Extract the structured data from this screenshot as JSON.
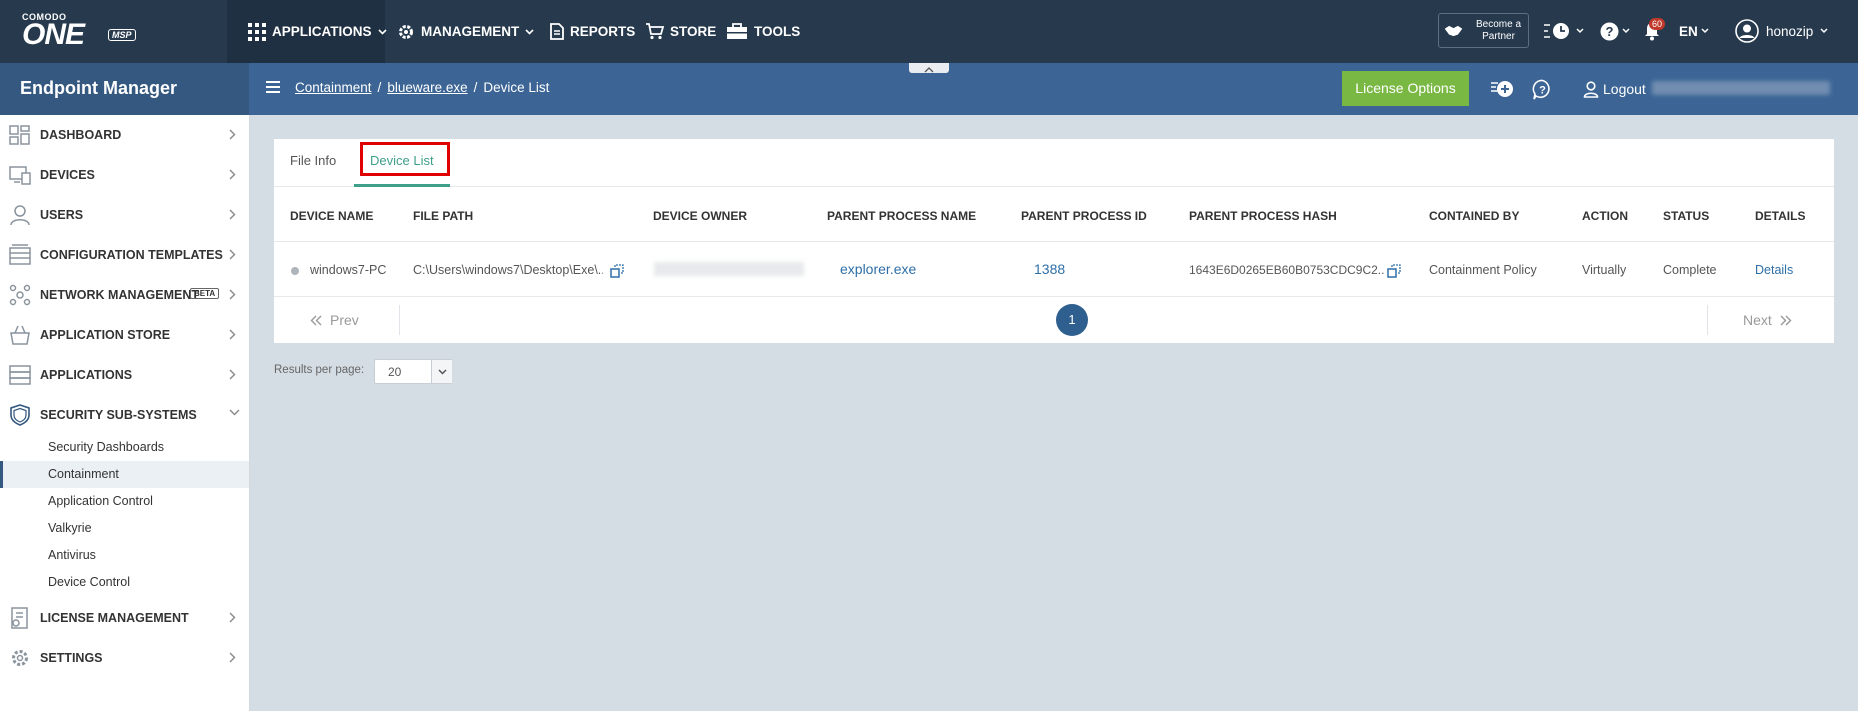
{
  "topbar": {
    "logo_small": "COMODO",
    "logo_big": "ONE",
    "logo_msp": "MSP",
    "nav": [
      {
        "label": "APPLICATIONS",
        "icon": "grid-icon"
      },
      {
        "label": "MANAGEMENT",
        "icon": "gear-icon"
      },
      {
        "label": "REPORTS",
        "icon": "document-icon"
      },
      {
        "label": "STORE",
        "icon": "cart-icon"
      },
      {
        "label": "TOOLS",
        "icon": "toolbox-icon"
      }
    ],
    "partner_label": "Become a Partner",
    "notification_count": "60",
    "language": "EN",
    "username": "honozip"
  },
  "subbar": {
    "brand": "Endpoint Manager",
    "breadcrumb": [
      "Containment",
      "blueware.exe",
      "Device List"
    ],
    "breadcrumb_sep": "/",
    "license_button": "License Options",
    "logout_label": "Logout"
  },
  "sidebar": {
    "items": [
      {
        "label": "DASHBOARD",
        "icon": "dashboard-icon"
      },
      {
        "label": "DEVICES",
        "icon": "devices-icon"
      },
      {
        "label": "USERS",
        "icon": "user-icon"
      },
      {
        "label": "CONFIGURATION TEMPLATES",
        "icon": "templates-icon"
      },
      {
        "label": "NETWORK MANAGEMENT",
        "icon": "network-icon",
        "badge": "BETA"
      },
      {
        "label": "APPLICATION STORE",
        "icon": "basket-icon"
      },
      {
        "label": "APPLICATIONS",
        "icon": "apps-icon"
      },
      {
        "label": "SECURITY SUB-SYSTEMS",
        "icon": "shield-icon"
      },
      {
        "label": "LICENSE MANAGEMENT",
        "icon": "license-icon"
      },
      {
        "label": "SETTINGS",
        "icon": "gear-icon"
      }
    ],
    "subitems": [
      "Security Dashboards",
      "Containment",
      "Application Control",
      "Valkyrie",
      "Antivirus",
      "Device Control"
    ],
    "active_subitem": "Containment"
  },
  "tabs": [
    "File Info",
    "Device List"
  ],
  "active_tab": "Device List",
  "table": {
    "columns": [
      "DEVICE NAME",
      "FILE PATH",
      "DEVICE OWNER",
      "PARENT PROCESS NAME",
      "PARENT PROCESS ID",
      "PARENT PROCESS HASH",
      "CONTAINED BY",
      "ACTION",
      "STATUS",
      "DETAILS"
    ],
    "rows": [
      {
        "device_name": "windows7-PC",
        "file_path": "C:\\Users\\windows7\\Desktop\\Exe\\...",
        "device_owner": "",
        "parent_process_name": "explorer.exe",
        "parent_process_id": "1388",
        "parent_process_hash": "1643E6D0265EB60B0753CDC9C2...",
        "contained_by": "Containment Policy",
        "action": "Virtually",
        "status": "Complete",
        "details": "Details"
      }
    ]
  },
  "pager": {
    "prev": "Prev",
    "next": "Next",
    "current_page": "1"
  },
  "results_per_page": {
    "label": "Results per page:",
    "value": "20"
  },
  "colors": {
    "topbar": "#26394d",
    "subbar": "#3c6596",
    "accent_green": "#7ab844",
    "tab_active": "#3fa08a",
    "highlight": "#e00000"
  }
}
